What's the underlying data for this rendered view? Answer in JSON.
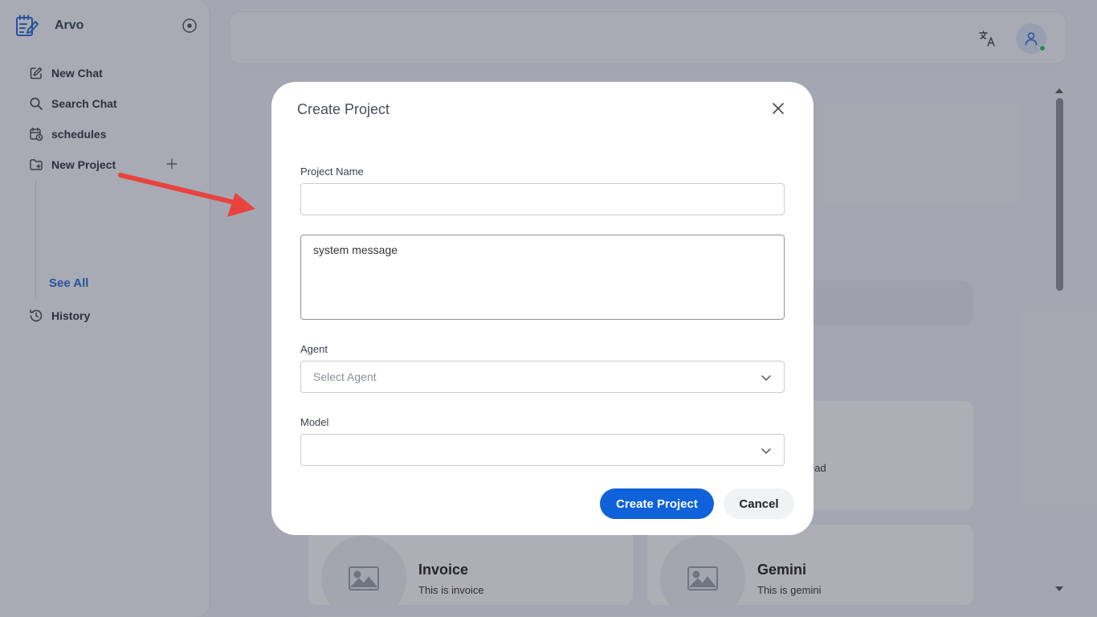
{
  "sidebar": {
    "brand": "Arvo",
    "items": [
      {
        "label": "New Chat",
        "icon": "edit-icon"
      },
      {
        "label": "Search Chat",
        "icon": "search-icon"
      },
      {
        "label": "schedules",
        "icon": "calendar-clock-icon"
      },
      {
        "label": "New Project",
        "icon": "folder-plus-icon"
      },
      {
        "label": "History",
        "icon": "history-icon"
      }
    ],
    "see_all": "See All"
  },
  "header": {
    "translate_icon": "translate-icon",
    "avatar_icon": "user-icon",
    "status_color": "#22c55e"
  },
  "background": {
    "cards": [
      {
        "title": "Invoice",
        "description": "This is invoice"
      },
      {
        "title": "Gemini",
        "description": "This is gemini"
      }
    ],
    "partial_text": "ead"
  },
  "modal": {
    "title": "Create Project",
    "project_name_label": "Project Name",
    "project_name_value": "",
    "system_message_placeholder": "system message",
    "agent_label": "Agent",
    "agent_placeholder": "Select Agent",
    "model_label": "Model",
    "model_value": "",
    "create_button": "Create Project",
    "cancel_button": "Cancel"
  },
  "colors": {
    "primary": "#0f62d9",
    "link": "#2a6bd6",
    "annotation_arrow": "#e8433f"
  }
}
